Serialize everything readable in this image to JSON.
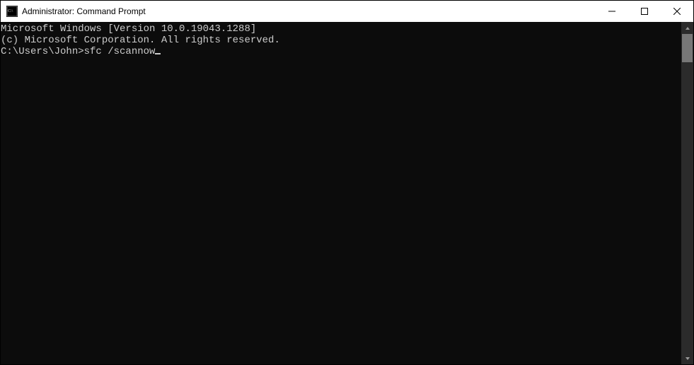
{
  "window": {
    "title": "Administrator: Command Prompt"
  },
  "terminal": {
    "line1": "Microsoft Windows [Version 10.0.19043.1288]",
    "line2": "(c) Microsoft Corporation. All rights reserved.",
    "blank": "",
    "prompt": "C:\\Users\\John>",
    "command": "sfc /scannow"
  }
}
